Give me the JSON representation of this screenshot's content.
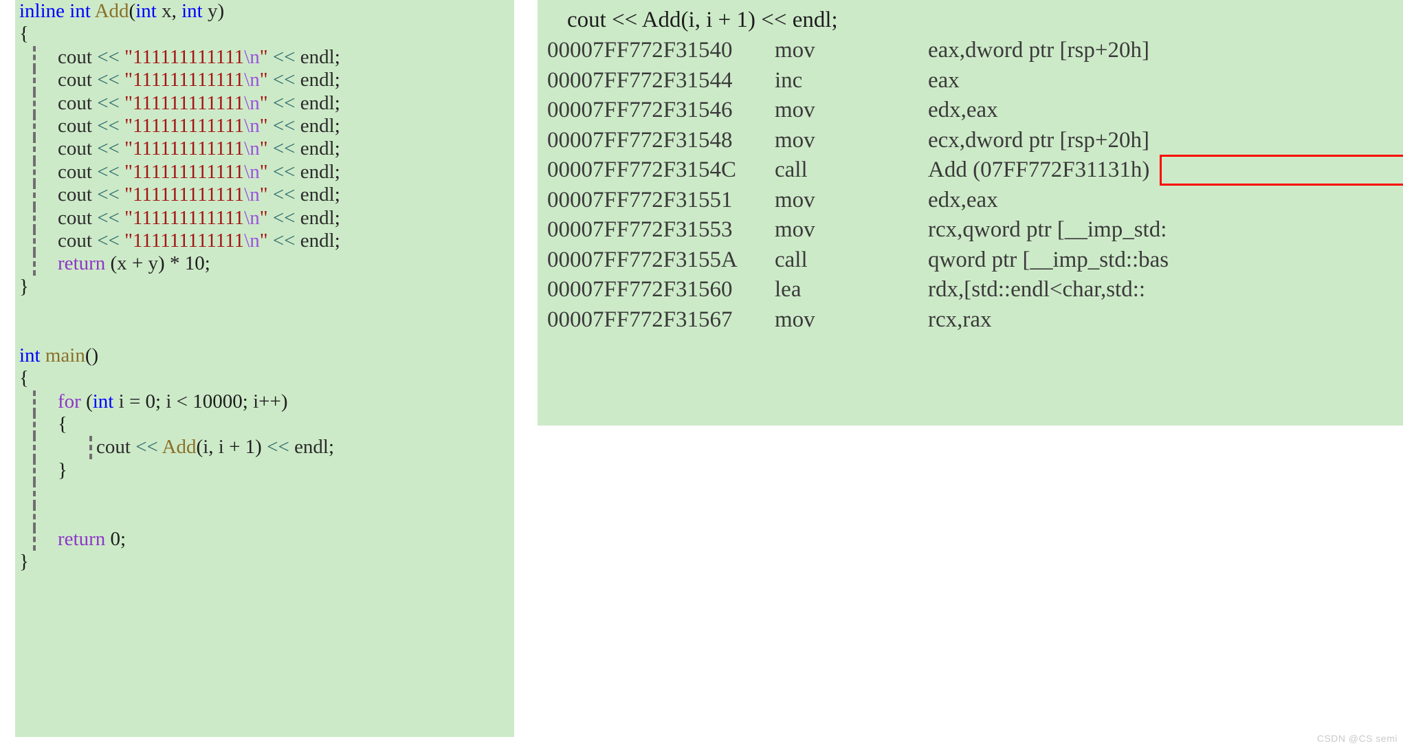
{
  "source_panel": {
    "language": "cpp",
    "background_color": "#cdeac8",
    "lines": [
      {
        "id": "fn-signature",
        "indent": 0,
        "guides": 0,
        "text": "inline int Add(int x, int y)"
      },
      {
        "id": "fn-open-brace",
        "indent": 0,
        "guides": 0,
        "text": "{"
      },
      {
        "id": "cout-1",
        "indent": 1,
        "guides": 1,
        "text": "cout << \"111111111111\\n\" << endl;"
      },
      {
        "id": "cout-2",
        "indent": 1,
        "guides": 1,
        "text": "cout << \"111111111111\\n\" << endl;"
      },
      {
        "id": "cout-3",
        "indent": 1,
        "guides": 1,
        "text": "cout << \"111111111111\\n\" << endl;"
      },
      {
        "id": "cout-4",
        "indent": 1,
        "guides": 1,
        "text": "cout << \"111111111111\\n\" << endl;"
      },
      {
        "id": "cout-5",
        "indent": 1,
        "guides": 1,
        "text": "cout << \"111111111111\\n\" << endl;"
      },
      {
        "id": "cout-6",
        "indent": 1,
        "guides": 1,
        "text": "cout << \"111111111111\\n\" << endl;"
      },
      {
        "id": "cout-7",
        "indent": 1,
        "guides": 1,
        "text": "cout << \"111111111111\\n\" << endl;"
      },
      {
        "id": "cout-8",
        "indent": 1,
        "guides": 1,
        "text": "cout << \"111111111111\\n\" << endl;"
      },
      {
        "id": "cout-9",
        "indent": 1,
        "guides": 1,
        "text": "cout << \"111111111111\\n\" << endl;"
      },
      {
        "id": "fn-return",
        "indent": 1,
        "guides": 1,
        "text": "return (x + y) * 10;"
      },
      {
        "id": "fn-close-brace",
        "indent": 0,
        "guides": 0,
        "text": "}"
      },
      {
        "id": "blank-1",
        "indent": 0,
        "guides": 0,
        "text": ""
      },
      {
        "id": "blank-2",
        "indent": 0,
        "guides": 0,
        "text": ""
      },
      {
        "id": "main-signature",
        "indent": 0,
        "guides": 0,
        "text": "int main()"
      },
      {
        "id": "main-open-brace",
        "indent": 0,
        "guides": 0,
        "text": "{"
      },
      {
        "id": "for-header",
        "indent": 1,
        "guides": 1,
        "text": "for (int i = 0; i < 10000; i++)"
      },
      {
        "id": "for-open-brace",
        "indent": 1,
        "guides": 1,
        "text": "{"
      },
      {
        "id": "for-body-cout",
        "indent": 2,
        "guides": 2,
        "text": "cout << Add(i, i + 1) << endl;"
      },
      {
        "id": "for-close-brace",
        "indent": 1,
        "guides": 1,
        "text": "}"
      },
      {
        "id": "blank-3",
        "indent": 0,
        "guides": 1,
        "text": ""
      },
      {
        "id": "blank-4",
        "indent": 0,
        "guides": 1,
        "text": ""
      },
      {
        "id": "main-return",
        "indent": 1,
        "guides": 1,
        "text": "return 0;"
      },
      {
        "id": "main-close-brace",
        "indent": 0,
        "guides": 0,
        "text": "}"
      }
    ],
    "syntax_colors": {
      "keyword": "#0000ff",
      "control": "#8f35c8",
      "function": "#8a7028",
      "string": "#a31515",
      "escape": "#9b51e0",
      "stream_operator": "#2d6b6b",
      "plain": "#1d1d1d"
    }
  },
  "disassembly_panel": {
    "background_color": "#cdeac8",
    "source_echo": "    cout << Add(i, i + 1) << endl;",
    "columns": [
      "address",
      "mnemonic",
      "operands"
    ],
    "rows": [
      {
        "address": "00007FF772F31540",
        "mnemonic": "mov",
        "operands": "eax,dword ptr [rsp+20h]",
        "highlighted": false
      },
      {
        "address": "00007FF772F31544",
        "mnemonic": "inc",
        "operands": "eax",
        "highlighted": false
      },
      {
        "address": "00007FF772F31546",
        "mnemonic": "mov",
        "operands": "edx,eax",
        "highlighted": false
      },
      {
        "address": "00007FF772F31548",
        "mnemonic": "mov",
        "operands": "ecx,dword ptr [rsp+20h]",
        "highlighted": false
      },
      {
        "address": "00007FF772F3154C",
        "mnemonic": "call",
        "operands": "Add (07FF772F31131h)",
        "highlighted": true
      },
      {
        "address": "00007FF772F31551",
        "mnemonic": "mov",
        "operands": "edx,eax",
        "highlighted": false
      },
      {
        "address": "00007FF772F31553",
        "mnemonic": "mov",
        "operands": "rcx,qword ptr [__imp_std:",
        "highlighted": false
      },
      {
        "address": "00007FF772F3155A",
        "mnemonic": "call",
        "operands": "qword ptr [__imp_std::bas",
        "highlighted": false
      },
      {
        "address": "00007FF772F31560",
        "mnemonic": "lea",
        "operands": "rdx,[std::endl<char,std::",
        "highlighted": false
      },
      {
        "address": "00007FF772F31567",
        "mnemonic": "mov",
        "operands": "rcx,rax",
        "highlighted": false
      }
    ],
    "highlight": {
      "target_address": "00007FF772F3154C",
      "color": "#ff0000",
      "label": "call Add (07FF772F31131h)"
    }
  },
  "watermark": {
    "text": "CSDN @CS semi",
    "color": "#c9c9c9"
  }
}
